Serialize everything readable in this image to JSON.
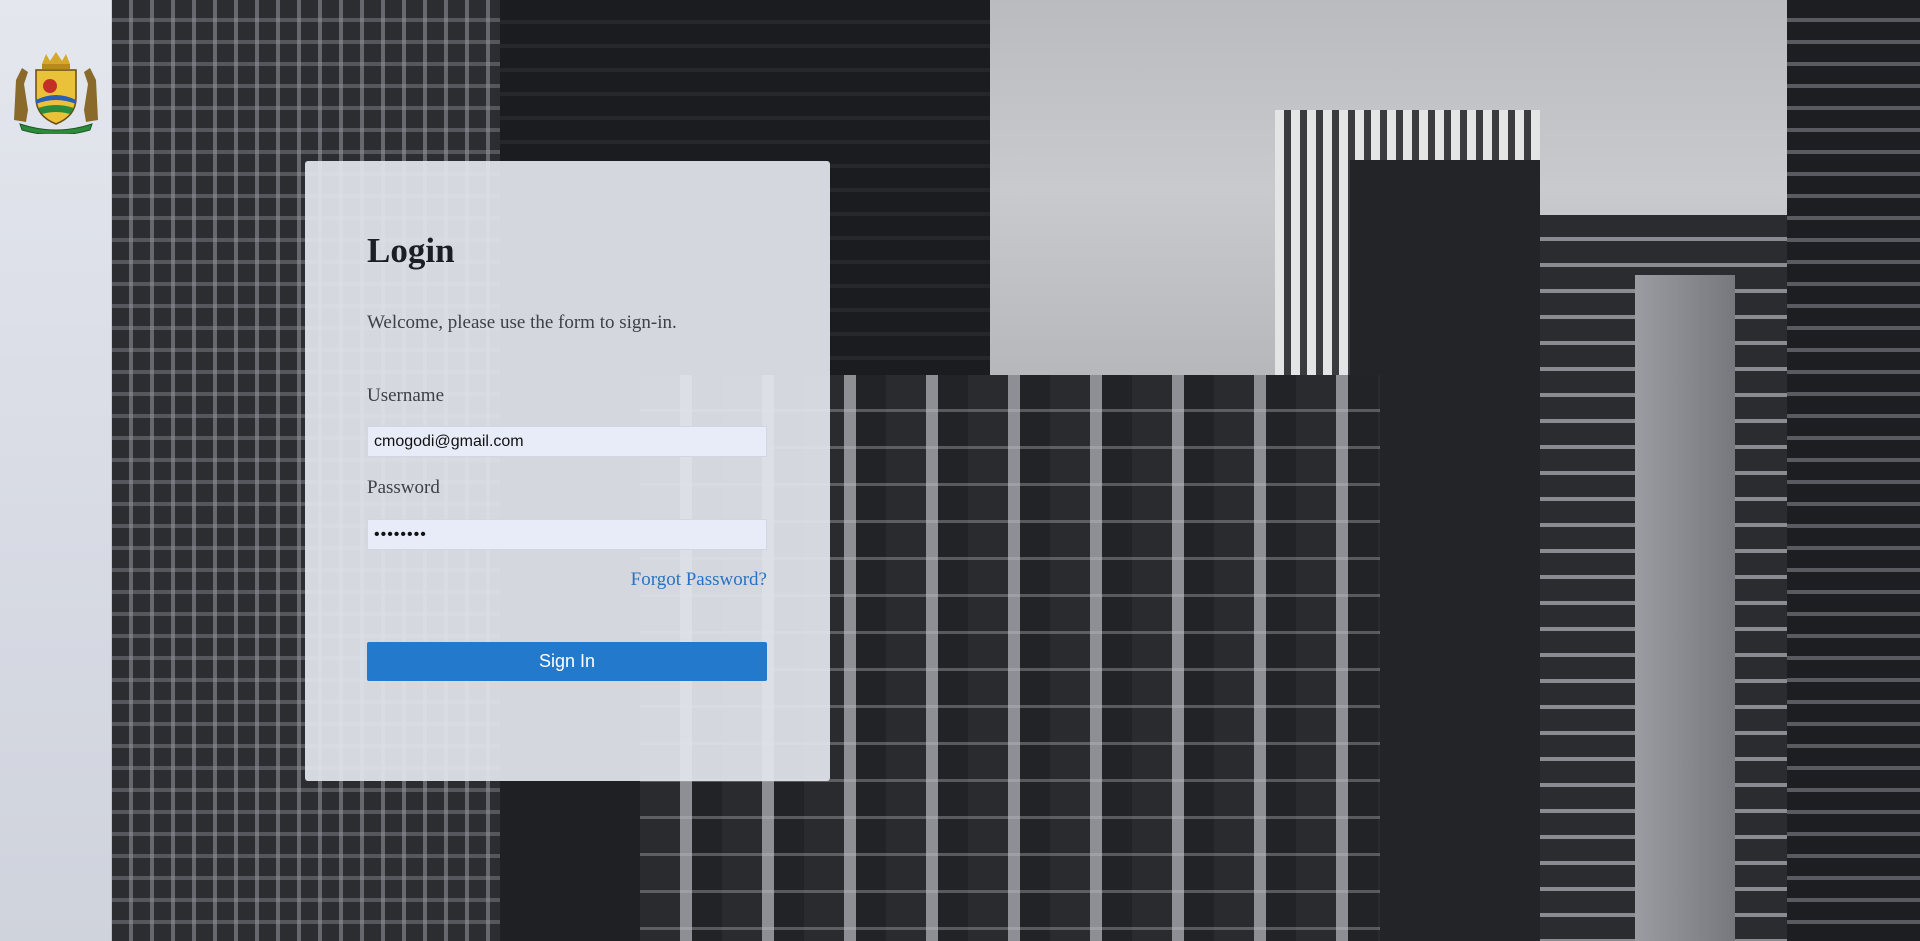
{
  "logo": {
    "name": "crest-logo"
  },
  "login": {
    "title": "Login",
    "subtitle": "Welcome, please use the form to sign-in.",
    "username_label": "Username",
    "username_value": "cmogodi@gmail.com",
    "password_label": "Password",
    "password_value": "••••••••",
    "forgot_label": "Forgot Password?",
    "signin_label": "Sign In"
  },
  "colors": {
    "accent": "#2379cc",
    "link": "#2872c6",
    "card_bg": "#e2e5ec",
    "input_bg": "#e8ecf8"
  }
}
